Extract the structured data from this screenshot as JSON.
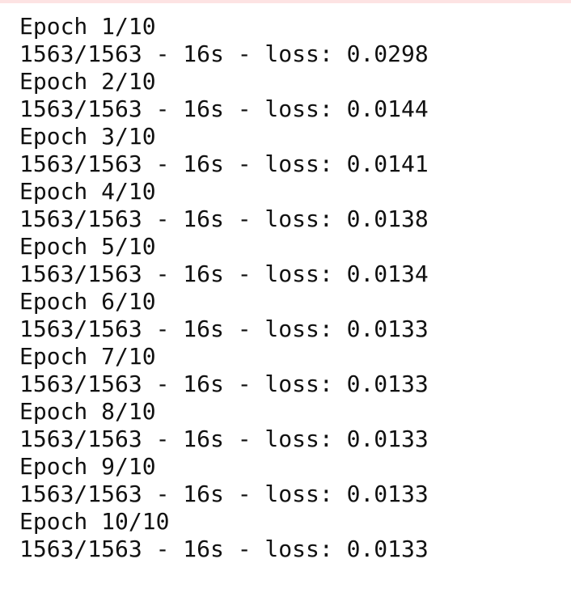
{
  "output": {
    "lines": [
      "Epoch 1/10",
      "1563/1563 - 16s - loss: 0.0298",
      "Epoch 2/10",
      "1563/1563 - 16s - loss: 0.0144",
      "Epoch 3/10",
      "1563/1563 - 16s - loss: 0.0141",
      "Epoch 4/10",
      "1563/1563 - 16s - loss: 0.0138",
      "Epoch 5/10",
      "1563/1563 - 16s - loss: 0.0134",
      "Epoch 6/10",
      "1563/1563 - 16s - loss: 0.0133",
      "Epoch 7/10",
      "1563/1563 - 16s - loss: 0.0133",
      "Epoch 8/10",
      "1563/1563 - 16s - loss: 0.0133",
      "Epoch 9/10",
      "1563/1563 - 16s - loss: 0.0133",
      "Epoch 10/10",
      "1563/1563 - 16s - loss: 0.0133"
    ]
  },
  "colors": {
    "text": "#111111",
    "background": "#ffffff",
    "error_border": "#fde3e3"
  }
}
